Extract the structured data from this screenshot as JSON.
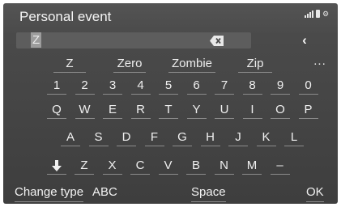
{
  "header": {
    "title": "Personal event"
  },
  "input": {
    "value": "Z"
  },
  "icons": {
    "delete": "backspace-icon",
    "back": "chevron-left-icon",
    "shift": "arrow-down-icon"
  },
  "suggestions": [
    "Z",
    "Zero",
    "Zombie",
    "Zip"
  ],
  "more_label": "...",
  "keyboard": {
    "numbers": [
      "1",
      "2",
      "3",
      "4",
      "5",
      "6",
      "7",
      "8",
      "9",
      "0"
    ],
    "row1": [
      "Q",
      "W",
      "E",
      "R",
      "T",
      "Y",
      "U",
      "I",
      "O",
      "P"
    ],
    "row2": [
      "A",
      "S",
      "D",
      "F",
      "G",
      "H",
      "J",
      "K",
      "L"
    ],
    "row3": [
      "Z",
      "X",
      "C",
      "V",
      "B",
      "N",
      "M",
      "–"
    ]
  },
  "bottom": {
    "change_type": "Change type",
    "mode": "ABC",
    "space": "Space",
    "ok": "OK"
  }
}
